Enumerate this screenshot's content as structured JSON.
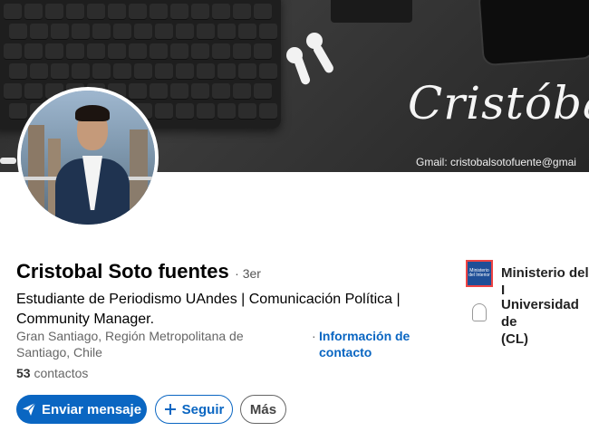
{
  "banner": {
    "signature": "Cristóbal So",
    "gmail": "Gmail: cristobalsotofuente@gmai"
  },
  "profile": {
    "name": "Cristobal Soto fuentes",
    "degree": "· 3er",
    "headline": "Estudiante de Periodismo UAndes | Comunicación Política | Community Manager.",
    "location": "Gran Santiago, Región Metropolitana de Santiago, Chile",
    "contact_dot": "·",
    "contact_link": "Información de contacto",
    "connections_count": "53",
    "connections_label": "contactos"
  },
  "actions": {
    "message": "Enviar mensaje",
    "follow": "Seguir",
    "more": "Más"
  },
  "organizations": [
    {
      "name": "Ministerio del I",
      "logo_text": "Ministerio del Interior"
    },
    {
      "name": "Universidad de (CL)",
      "line1": "Universidad de",
      "line2": "(CL)"
    }
  ],
  "colors": {
    "accent": "#0a66c2",
    "text_secondary": "#666666"
  }
}
